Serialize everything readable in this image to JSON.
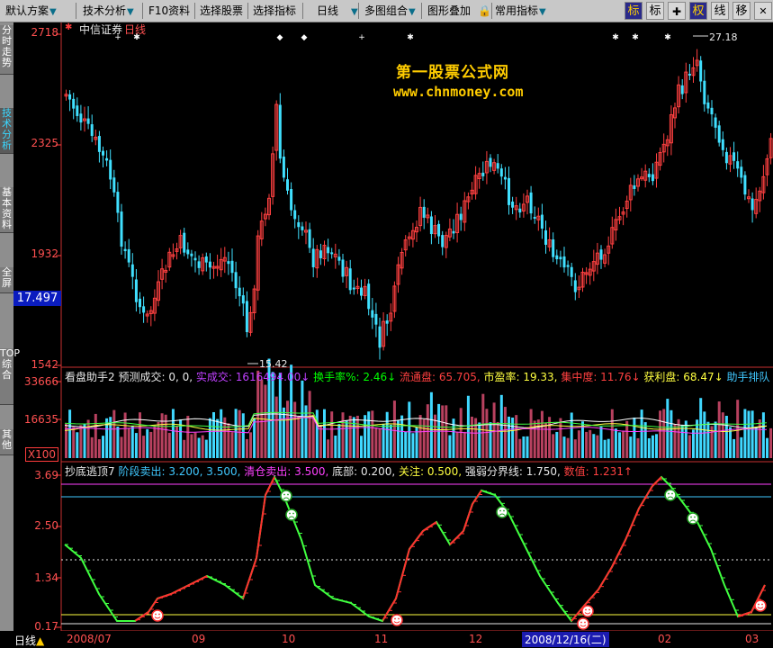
{
  "toolbar": {
    "items": [
      "默认方案",
      "技术分析",
      "F10资料",
      "选择股票",
      "选择指标",
      "日线",
      "多图组合",
      "图形叠加",
      "常用指标"
    ],
    "buttons": [
      "标",
      "标",
      "权",
      "线",
      "移"
    ],
    "close": "✕"
  },
  "left_tabs": [
    "分时走势",
    "技术分析",
    "基本资料",
    "全屏",
    "TOP综合",
    "其他"
  ],
  "main_chart": {
    "stock_name": "中信证券",
    "period": "日线",
    "y_ticks": [
      "2718",
      "2325",
      "1932",
      "1542"
    ],
    "current_price": "17.497",
    "high_label": "27.18",
    "low_label": "15.42",
    "watermark_name": "第一股票公式网",
    "watermark_url": "www.chnmoney.com"
  },
  "volume_panel": {
    "title": "看盘助手2",
    "fields": [
      {
        "text": "预测成交: 0, 0,",
        "color": "#e8e8e8"
      },
      {
        "text": "实成交: 1616494.00↓",
        "color": "#c040ff"
      },
      {
        "text": "换手率%: 2.46↓",
        "color": "#00ff00"
      },
      {
        "text": "流通盘: 65.705,",
        "color": "#ff4040"
      },
      {
        "text": "市盈率: 19.33,",
        "color": "#ffff40"
      },
      {
        "text": "集中度: 11.76↓",
        "color": "#ff4040"
      },
      {
        "text": "获利盘: 68.47↓",
        "color": "#ffff40"
      },
      {
        "text": "助手排队",
        "color": "#40c8ff"
      }
    ],
    "y_ticks": [
      "33666",
      "16635"
    ],
    "unit": "X100"
  },
  "indicator_panel": {
    "title": "抄底逃顶7",
    "fields": [
      {
        "text": "阶段卖出: 3.200, 3.500,",
        "color": "#40c8ff"
      },
      {
        "text": "清仓卖出: 3.500,",
        "color": "#ff40ff"
      },
      {
        "text": "底部: 0.200,",
        "color": "#e8e8e8"
      },
      {
        "text": "关注: 0.500,",
        "color": "#ffff40"
      },
      {
        "text": "强弱分界线: 1.750,",
        "color": "#e8e8e8"
      },
      {
        "text": "数值: 1.231↑",
        "color": "#ff4040"
      }
    ],
    "y_ticks": [
      "3.69",
      "2.50",
      "1.34",
      "0.17"
    ]
  },
  "bottom": {
    "period_label": "日线",
    "dates": [
      "2008/07",
      "09",
      "10",
      "11",
      "12",
      "01",
      "02",
      "03"
    ],
    "cursor_date": "2008/12/16(二)"
  },
  "chart_data": {
    "type": "candlestick",
    "title": "中信证券 日线",
    "ylim": [
      15.42,
      27.18
    ],
    "high": 27.18,
    "low": 15.42,
    "current": 17.497,
    "indicator": {
      "name": "抄底逃顶7",
      "lines": {
        "阶段卖出": [
          3.2,
          3.5
        ],
        "清仓卖出": 3.5,
        "底部": 0.2,
        "关注": 0.5,
        "强弱分界线": 1.75,
        "数值": 1.231
      }
    }
  }
}
